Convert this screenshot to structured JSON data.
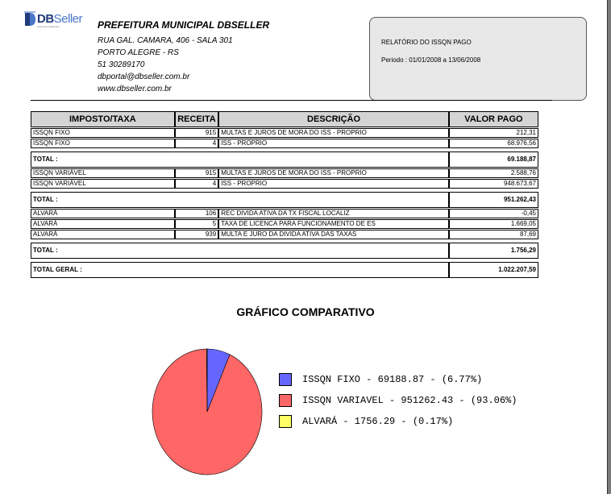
{
  "org": {
    "name": "PREFEITURA MUNICIPAL DBSELLER",
    "lines": [
      "RUA GAL. CAMARA, 406 - SALA 301",
      "PORTO ALEGRE - RS",
      "51 30289170",
      "dbportal@dbseller.com.br",
      "www.dbseller.com.br"
    ]
  },
  "logo": {
    "text": "DBSeller",
    "text_db": "DB",
    "text_seller": "Seller",
    "tagline": "sistemas inteligentes"
  },
  "report": {
    "title": "RELATÓRIO DO ISSQN PAGO",
    "period": "Periodo : 01/01/2008 a 13/06/2008"
  },
  "table": {
    "headers": [
      "IMPOSTO/TAXA",
      "RECEITA",
      "DESCRIÇÃO",
      "VALOR PAGO"
    ],
    "rows": [
      {
        "kind": "data",
        "imposto": "ISSQN FIXO",
        "receita": "915",
        "descricao": "MULTAS E JUROS DE MORA DO ISS - PROPRIO",
        "valor": "212,31"
      },
      {
        "kind": "data",
        "imposto": "ISSQN FIXO",
        "receita": "4",
        "descricao": "ISS - PROPRIO",
        "valor": "68.976,56"
      },
      {
        "kind": "total",
        "label": "TOTAL :",
        "valor": "69.188,87"
      },
      {
        "kind": "data",
        "imposto": "ISSQN VARIÁVEL",
        "receita": "915",
        "descricao": "MULTAS E JUROS DE MORA DO ISS - PROPRIO",
        "valor": "2.588,76"
      },
      {
        "kind": "data",
        "imposto": "ISSQN VARIÁVEL",
        "receita": "4",
        "descricao": "ISS - PROPRIO",
        "valor": "948.673,67"
      },
      {
        "kind": "total",
        "label": "TOTAL :",
        "valor": "951.262,43"
      },
      {
        "kind": "data",
        "imposto": "ALVARÁ",
        "receita": "106",
        "descricao": "REC DIVIDA ATIVA DA TX FISCAL LOCALIZ",
        "valor": "-0,45"
      },
      {
        "kind": "data",
        "imposto": "ALVARÁ",
        "receita": "5",
        "descricao": "TAXA DE LICENCA PARA FUNCIONAMENTO DE ES",
        "valor": "1.669,05"
      },
      {
        "kind": "data",
        "imposto": "ALVARÁ",
        "receita": "939",
        "descricao": "MULTA E JURO DA DIVIDA ATIVA DAS TAXAS",
        "valor": "87,69"
      },
      {
        "kind": "total",
        "label": "TOTAL :",
        "valor": "1.756,29"
      },
      {
        "kind": "total",
        "label": "TOTAL GERAL :",
        "valor": "1.022.207,59"
      }
    ]
  },
  "chart_title": "GRÁFICO COMPARATIVO",
  "chart_data": {
    "type": "pie",
    "title": "GRÁFICO COMPARATIVO",
    "slices": [
      {
        "name": "ISSQN FIXO",
        "value": 69188.87,
        "percent": 6.77,
        "color": "#6666ff",
        "label": "ISSQN FIXO - 69188.87 - (6.77%)"
      },
      {
        "name": "ISSQN VARIAVEL",
        "value": 951262.43,
        "percent": 93.06,
        "color": "#ff6666",
        "label": "ISSQN VARIAVEL - 951262.43 - (93.06%)"
      },
      {
        "name": "ALVARÁ",
        "value": 1756.29,
        "percent": 0.17,
        "color": "#ffff66",
        "label": "ALVARÁ - 1756.29 - (0.17%)"
      }
    ],
    "legend_position": "right"
  }
}
